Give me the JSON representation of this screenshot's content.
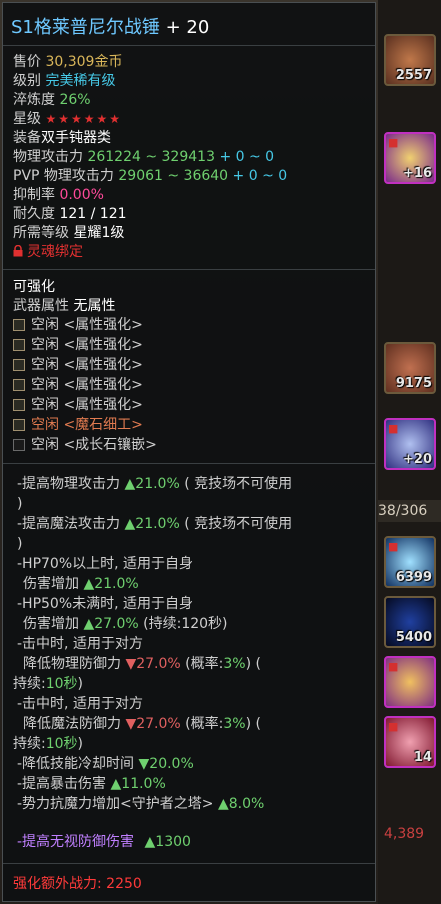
{
  "background": {
    "slots": [
      {
        "name": "item-slot-1",
        "count": "2557"
      },
      {
        "name": "item-slot-2",
        "count": "+16"
      },
      {
        "name": "item-slot-3",
        "count": "9175"
      },
      {
        "name": "item-slot-4",
        "count": "+20"
      },
      {
        "name": "item-slot-5",
        "count": "6399"
      },
      {
        "name": "item-slot-6",
        "count": "5400"
      },
      {
        "name": "item-slot-7",
        "count": ""
      },
      {
        "name": "item-slot-8",
        "count": "14"
      }
    ],
    "counter": "38/306",
    "bottom_value": "4,389"
  },
  "tooltip": {
    "title": "S1格莱普尼尔战锤",
    "title_plus": "+ 20",
    "price_label": "售价",
    "price_value": "30,309金币",
    "grade_label": "级别",
    "grade_value": "完美稀有级",
    "refine_label": "淬炼度",
    "refine_value": "26%",
    "star_label": "星级",
    "stars": "★★★★★★",
    "equip_label": "装备",
    "equip_value": "双手钝器类",
    "patk_label": "物理攻击力",
    "patk_value": "261224 ~ 329413",
    "patk_bonus": "+ 0 ~ 0",
    "pvp_label": "PVP 物理攻击力",
    "pvp_value": "29061 ~ 36640",
    "pvp_bonus": "+ 0 ~ 0",
    "suppress_label": "抑制率",
    "suppress_value": "0.00%",
    "durability_label": "耐久度",
    "durability_value": "121 / 121",
    "req_label": "所需等级",
    "req_value": "星耀1级",
    "soulbound": "灵魂绑定",
    "enhance_header": "可强化",
    "weapon_attr_label": "武器属性",
    "weapon_attr_value": "无属性",
    "sockets": [
      {
        "text": "空闲 <属性强化>",
        "style": "normal"
      },
      {
        "text": "空闲 <属性强化>",
        "style": "normal"
      },
      {
        "text": "空闲 <属性强化>",
        "style": "normal"
      },
      {
        "text": "空闲 <属性强化>",
        "style": "normal"
      },
      {
        "text": "空闲 <属性强化>",
        "style": "normal"
      },
      {
        "text": "空闲 <魔石细工>",
        "style": "red"
      },
      {
        "text": "空闲 <成长石镶嵌>",
        "style": "normal"
      }
    ],
    "effects": {
      "e1_text": "-提高物理攻击力",
      "e1_val": "▲21.0%",
      "e1_note": "( 竞技场不可使用",
      "e1_close": ")",
      "e2_text": "-提高魔法攻击力",
      "e2_val": "▲21.0%",
      "e2_note": "( 竞技场不可使用",
      "e2_close": ")",
      "e3_line1": "-HP70%以上时, 适用于自身",
      "e3_line2": "伤害增加",
      "e3_val": "▲21.0%",
      "e4_line1": "-HP50%未满时, 适用于自身",
      "e4_line2": "伤害增加",
      "e4_val": "▲27.0%",
      "e4_note": "(持续:120秒)",
      "e5_line1": "-击中时, 适用于对方",
      "e5_line2": "降低物理防御力",
      "e5_val": "▼27.0%",
      "e5_prob_open": "(概率:",
      "e5_prob": "3%",
      "e5_prob_close": ")",
      "e5_open": "(",
      "e5_dur_label": "持续:",
      "e5_dur": "10秒",
      "e5_dur_close": ")",
      "e6_line1": "-击中时, 适用于对方",
      "e6_line2": "降低魔法防御力",
      "e6_val": "▼27.0%",
      "e6_prob_open": "(概率:",
      "e6_prob": "3%",
      "e6_prob_close": ")",
      "e6_open": "(",
      "e6_dur_label": "持续:",
      "e6_dur": "10秒",
      "e6_dur_close": ")",
      "e7_text": "-降低技能冷却时间",
      "e7_val": "▼20.0%",
      "e8_text": "-提高暴击伤害",
      "e8_val": "▲11.0%",
      "e9_text": "-势力抗魔力增加<守护者之塔>",
      "e9_val": "▲8.0%",
      "e10_text": "-提高无视防御伤害",
      "e10_val": "▲1300"
    },
    "extra_power": "强化额外战力: 2250"
  },
  "colors": {
    "title": "#6ec8ff",
    "gold": "#d9b65a",
    "cyan": "#46c8e6",
    "green": "#6fd06f",
    "pink": "#ff4a9a",
    "red": "#e03030",
    "purple": "#c080ff"
  }
}
